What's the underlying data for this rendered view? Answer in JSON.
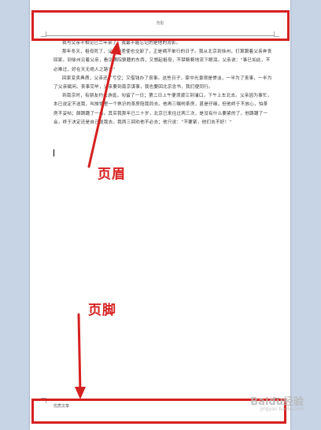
{
  "header": {
    "text": "背影"
  },
  "body": {
    "paragraphs": [
      "我与父亲不相见已二年余了，我最不能忘记的是他的背影。",
      "那年冬天，祖母死了，父亲的差使也交卸了，正是祸不单行的日子。我从北京到徐州，打算跟着父亲奔丧回家。到徐州见着父亲，看见满院狼藉的东西，又想起祖母，不禁簌簌地流下眼泪。父亲说：“事已如此，不必难过，好在天无绝人之路！”",
      "回家变卖典质，父亲还了亏空；又借钱办了丧事。这些日子，家中光景很是惨淡，一半为了丧事，一半为了父亲赋闲。丧事完毕，父亲要到南京谋事，我也要回北京念书，我们便同行。",
      "到南京时，有朋友约去游逛，勾留了一日；第二日上午便须渡江到浦口，下午上车北去。父亲因为事忙，本已说定不送我，叫旅馆里一个熟识的茶房陪我同去。他再三嘱咐茶房，甚是仔细。但他终于不放心，怕茶房不妥帖；颇踌躇了一会。其实我那年已二十岁，北京已来往过两三次，是没有什么要紧的了。他踌躇了一会，终于决定还是自己送我去。我两三回劝他不必去；他只说：“不要紧，他们去不好！”"
    ]
  },
  "footer": {
    "text": "优质文章"
  },
  "annotations": {
    "header_label": "页眉",
    "footer_label": "页脚"
  },
  "watermark": {
    "brand": "Baidu经验",
    "sub": "jingyan.baidu.com"
  },
  "colors": {
    "annotation": "#d62020",
    "background": "#c7d4e6"
  }
}
